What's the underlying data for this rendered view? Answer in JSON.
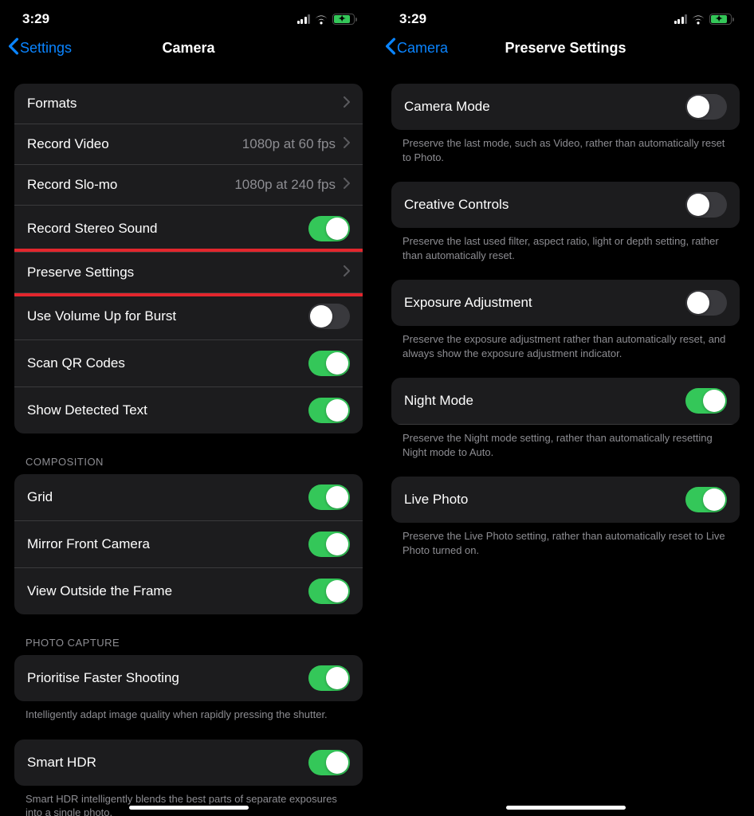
{
  "left": {
    "status": {
      "time": "3:29"
    },
    "nav": {
      "back": "Settings",
      "title": "Camera"
    },
    "group1": {
      "formats": "Formats",
      "record_video": "Record Video",
      "record_video_val": "1080p at 60 fps",
      "record_slomo": "Record Slo-mo",
      "record_slomo_val": "1080p at 240 fps",
      "stereo": "Record Stereo Sound",
      "preserve": "Preserve Settings",
      "volume_burst": "Use Volume Up for Burst",
      "scan_qr": "Scan QR Codes",
      "detected_text": "Show Detected Text"
    },
    "composition_header": "COMPOSITION",
    "group2": {
      "grid": "Grid",
      "mirror": "Mirror Front Camera",
      "outside_frame": "View Outside the Frame"
    },
    "photo_capture_header": "PHOTO CAPTURE",
    "group3": {
      "faster": "Prioritise Faster Shooting",
      "faster_footer": "Intelligently adapt image quality when rapidly pressing the shutter."
    },
    "group4": {
      "smart_hdr": "Smart HDR",
      "smart_hdr_footer": "Smart HDR intelligently blends the best parts of separate exposures into a single photo."
    }
  },
  "right": {
    "status": {
      "time": "3:29"
    },
    "nav": {
      "back": "Camera",
      "title": "Preserve Settings"
    },
    "camera_mode": "Camera Mode",
    "camera_mode_footer": "Preserve the last mode, such as Video, rather than automatically reset to Photo.",
    "creative": "Creative Controls",
    "creative_footer": "Preserve the last used filter, aspect ratio, light or depth setting, rather than automatically reset.",
    "exposure": "Exposure Adjustment",
    "exposure_footer": "Preserve the exposure adjustment rather than automatically reset, and always show the exposure adjustment indicator.",
    "night": "Night Mode",
    "night_footer": "Preserve the Night mode setting, rather than automatically resetting Night mode to Auto.",
    "live": "Live Photo",
    "live_footer": "Preserve the Live Photo setting, rather than automatically reset to Live Photo turned on."
  }
}
